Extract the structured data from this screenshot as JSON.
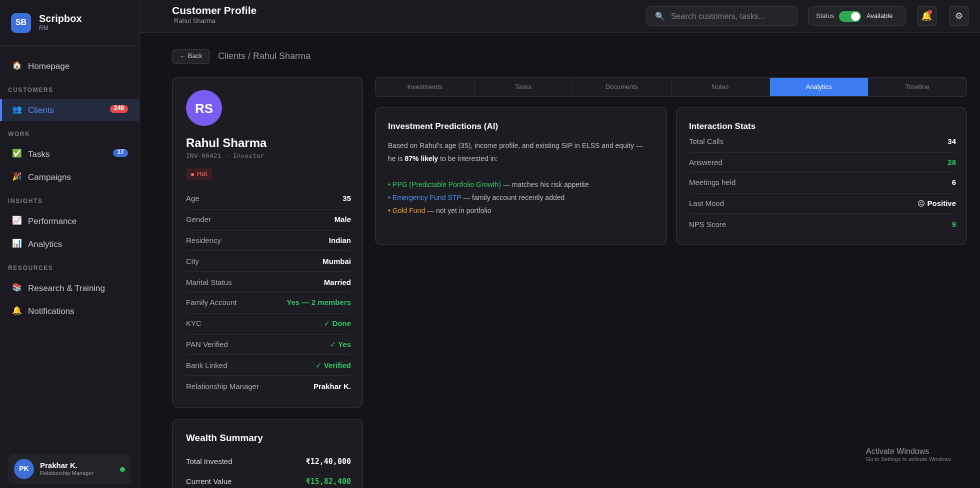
{
  "brand": {
    "logo": "SB",
    "name": "Scripbox",
    "sub": "RM"
  },
  "sidebar": {
    "homepage": {
      "label": "Homepage",
      "icon": "home-icon"
    },
    "sections": {
      "customers": "CUSTOMERS",
      "work": "WORK",
      "insights": "INSIGHTS",
      "resources": "RESOURCES"
    },
    "clients": {
      "label": "Clients",
      "badge": "248"
    },
    "tasks": {
      "label": "Tasks",
      "badge": "17"
    },
    "campaigns": {
      "label": "Campaigns"
    },
    "performance": {
      "label": "Performance"
    },
    "analytics": {
      "label": "Analytics"
    },
    "research": {
      "label": "Research & Training"
    },
    "notifications": {
      "label": "Notifications"
    }
  },
  "user": {
    "initials": "PK",
    "name": "Prakhar K.",
    "role": "Relationship Manager"
  },
  "header": {
    "title": "Customer Profile",
    "subtitle": "Rahul Sharma",
    "search_placeholder": "Search customers, tasks...",
    "status_label": "Status",
    "status_value": "Available"
  },
  "breadcrumb": {
    "back": "← Back",
    "path": "Clients / Rahul Sharma"
  },
  "profile": {
    "initials": "RS",
    "name": "Rahul Sharma",
    "id": "INV-00421 · Investor",
    "tag": "Hot",
    "fields": [
      {
        "label": "Age",
        "value": "35"
      },
      {
        "label": "Gender",
        "value": "Male"
      },
      {
        "label": "Residency",
        "value": "Indian"
      },
      {
        "label": "City",
        "value": "Mumbai"
      },
      {
        "label": "Marital Status",
        "value": "Married"
      },
      {
        "label": "Family Account",
        "value": "Yes — 2 members"
      },
      {
        "label": "KYC",
        "value": "✓ Done"
      },
      {
        "label": "PAN Verified",
        "value": "✓ Yes"
      },
      {
        "label": "Bank Linked",
        "value": "✓ Verified"
      },
      {
        "label": "Relationship Manager",
        "value": "Prakhar K."
      }
    ]
  },
  "wealth": {
    "title": "Wealth Summary",
    "total_invested_label": "Total Invested",
    "total_invested": "₹12,40,000",
    "current_value_label": "Current Value",
    "current_value": "₹15,82,400"
  },
  "tabs": [
    "Investments",
    "Tasks",
    "Documents",
    "Notes",
    "Analytics",
    "Timeline"
  ],
  "predictions": {
    "title": "Investment Predictions (AI)",
    "intro": "Based on Rahul's age (35), income profile, and existing SIP in ELSS and equity — he is ",
    "likely": "87% likely",
    "intro_end": " to be interested in:",
    "items": [
      {
        "name": "PPG (Predictable Portfolio Growth)",
        "note": " — matches his risk appetite"
      },
      {
        "name": "Emergency Fund STP",
        "note": " — family account recently added"
      },
      {
        "name": "Gold Fund",
        "note": " — not yet in portfolio"
      }
    ]
  },
  "stats": {
    "title": "Interaction Stats",
    "rows": [
      {
        "label": "Total Calls",
        "value": "34"
      },
      {
        "label": "Answered",
        "value": "28"
      },
      {
        "label": "Meetings held",
        "value": "6"
      },
      {
        "label": "Last Mood",
        "value": "😐 Positive"
      },
      {
        "label": "NPS Score",
        "value": "9"
      }
    ]
  },
  "watermark": {
    "line1": "Activate Windows",
    "line2": "Go to Settings to activate Windows."
  },
  "colors": {
    "accent": "#3d7bf0",
    "green": "#35c463",
    "danger": "#e24a4a",
    "violet": "#7a5cf0"
  }
}
